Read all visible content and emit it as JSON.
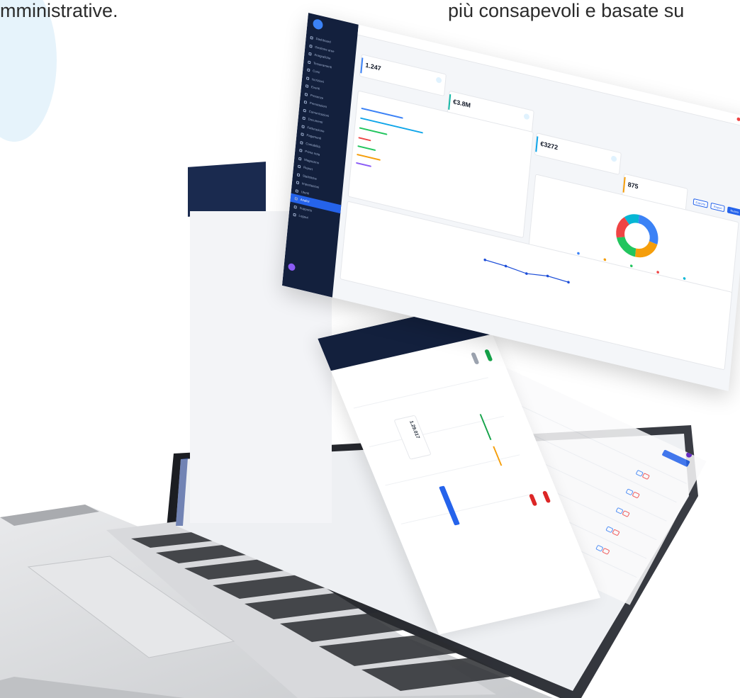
{
  "captions": {
    "left": "mministrative.",
    "right": "più consapevoli e basate su"
  },
  "dashboard": {
    "sidebar": {
      "items": [
        "Dashboard",
        "Gestione aree",
        "Anagrafiche",
        "Tesseramenti",
        "Corsi",
        "Iscrizioni",
        "Eventi",
        "Presenze",
        "Prenotazioni",
        "Comunicazioni",
        "Documenti",
        "Fatturazione",
        "Pagamenti",
        "Contabilità",
        "Prima nota",
        "Magazzino",
        "Report",
        "Statistiche",
        "Impostazioni",
        "Utenti",
        "Analisi",
        "Supporto",
        "Logout"
      ],
      "active_index": 20
    },
    "kpis": [
      {
        "value": "1.247"
      },
      {
        "value": "€3.8M"
      },
      {
        "value": "€3272"
      },
      {
        "value": "875"
      }
    ],
    "actions": {
      "export": "Esporta",
      "report": "Report",
      "new": "Nuovo"
    }
  },
  "chart_data": [
    {
      "type": "pie",
      "categories": [
        "",
        "",
        "",
        "",
        ""
      ],
      "values": [
        28,
        22,
        20,
        18,
        12
      ],
      "colors": [
        "#3b82f6",
        "#f59e0b",
        "#22c55e",
        "#ef4444",
        "#06b6d4"
      ],
      "legend_position": "bottom"
    },
    {
      "type": "line",
      "x": [
        1,
        2,
        3,
        4,
        5
      ],
      "series": [
        {
          "values": [
            60,
            58,
            54,
            58,
            56
          ]
        }
      ],
      "color": "#1d4ed8"
    }
  ],
  "second_screen": {
    "kpi": {
      "value": "1.29.017"
    },
    "pills": [
      {
        "color": "#16a34a"
      },
      {
        "color": "#9ca3af"
      }
    ],
    "tags": [
      {
        "color": "#dc2626"
      },
      {
        "color": "#dc2626"
      }
    ]
  }
}
